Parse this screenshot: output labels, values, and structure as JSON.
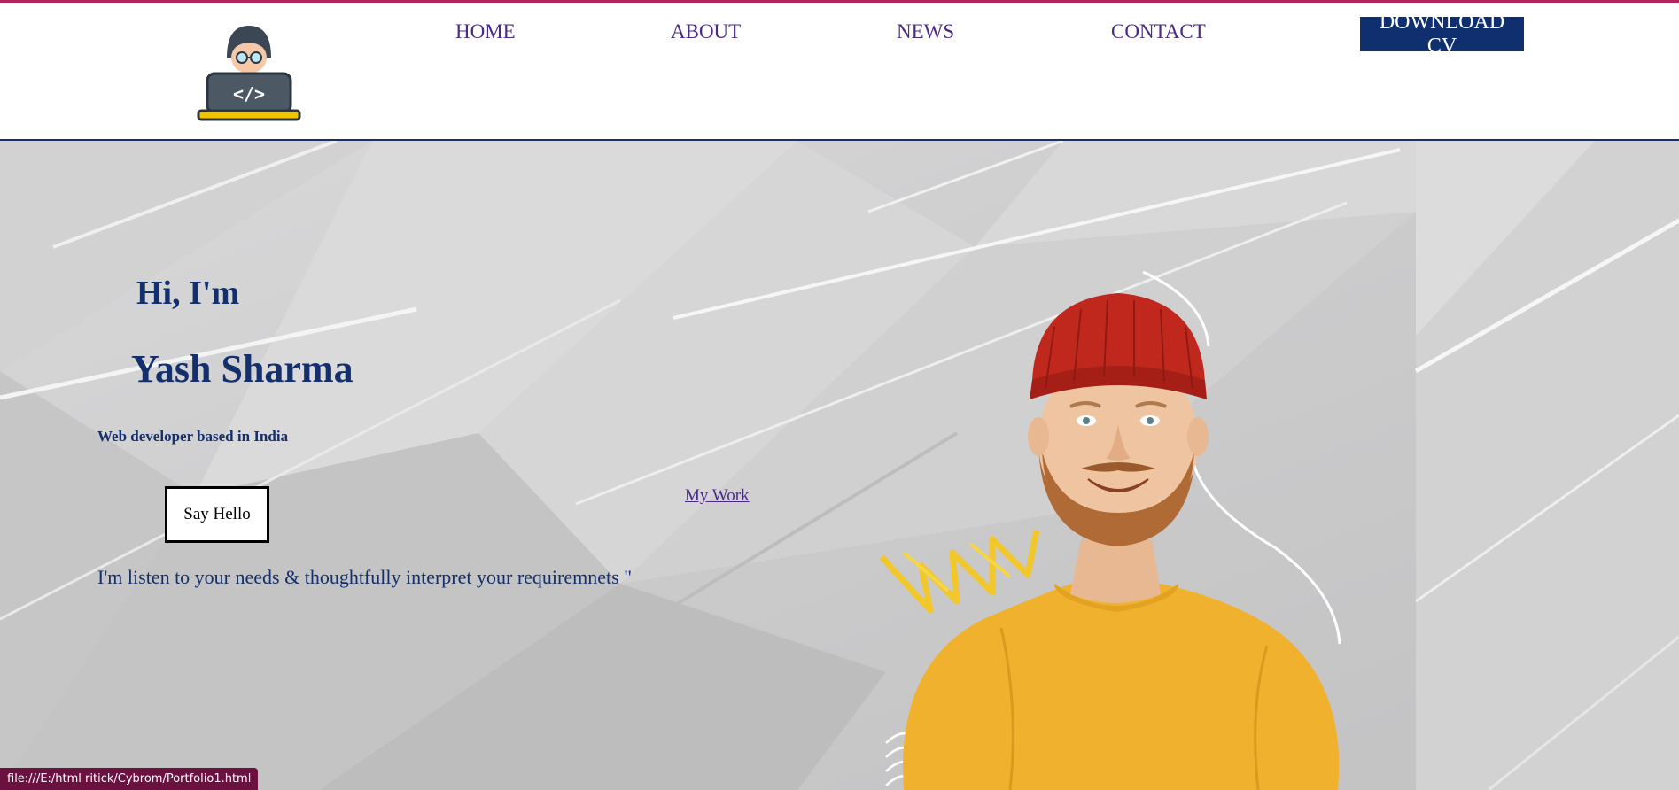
{
  "header": {
    "nav": [
      {
        "label": "HOME"
      },
      {
        "label": "ABOUT"
      },
      {
        "label": "NEWS"
      },
      {
        "label": "CONTACT"
      }
    ],
    "cta_label": "DOWNLOAD CV",
    "logo_icon": "developer-laptop-icon"
  },
  "hero": {
    "greeting": "Hi, I'm",
    "name": "Yash Sharma",
    "tagline": "Web developer based in India",
    "say_hello_label": "Say Hello",
    "my_work_label": "My Work",
    "quote": "I'm listen to your needs & thoughtfully interpret your requiremnets \""
  },
  "status_bar": {
    "url": "file:///E:/html ritick/Cybrom/Portfolio1.html"
  },
  "colors": {
    "accent_top": "#b0245a",
    "navy": "#14306c",
    "nav_text": "#4a2a86",
    "cta_bg": "#0f2f6e",
    "status_bg": "#6b1140"
  }
}
